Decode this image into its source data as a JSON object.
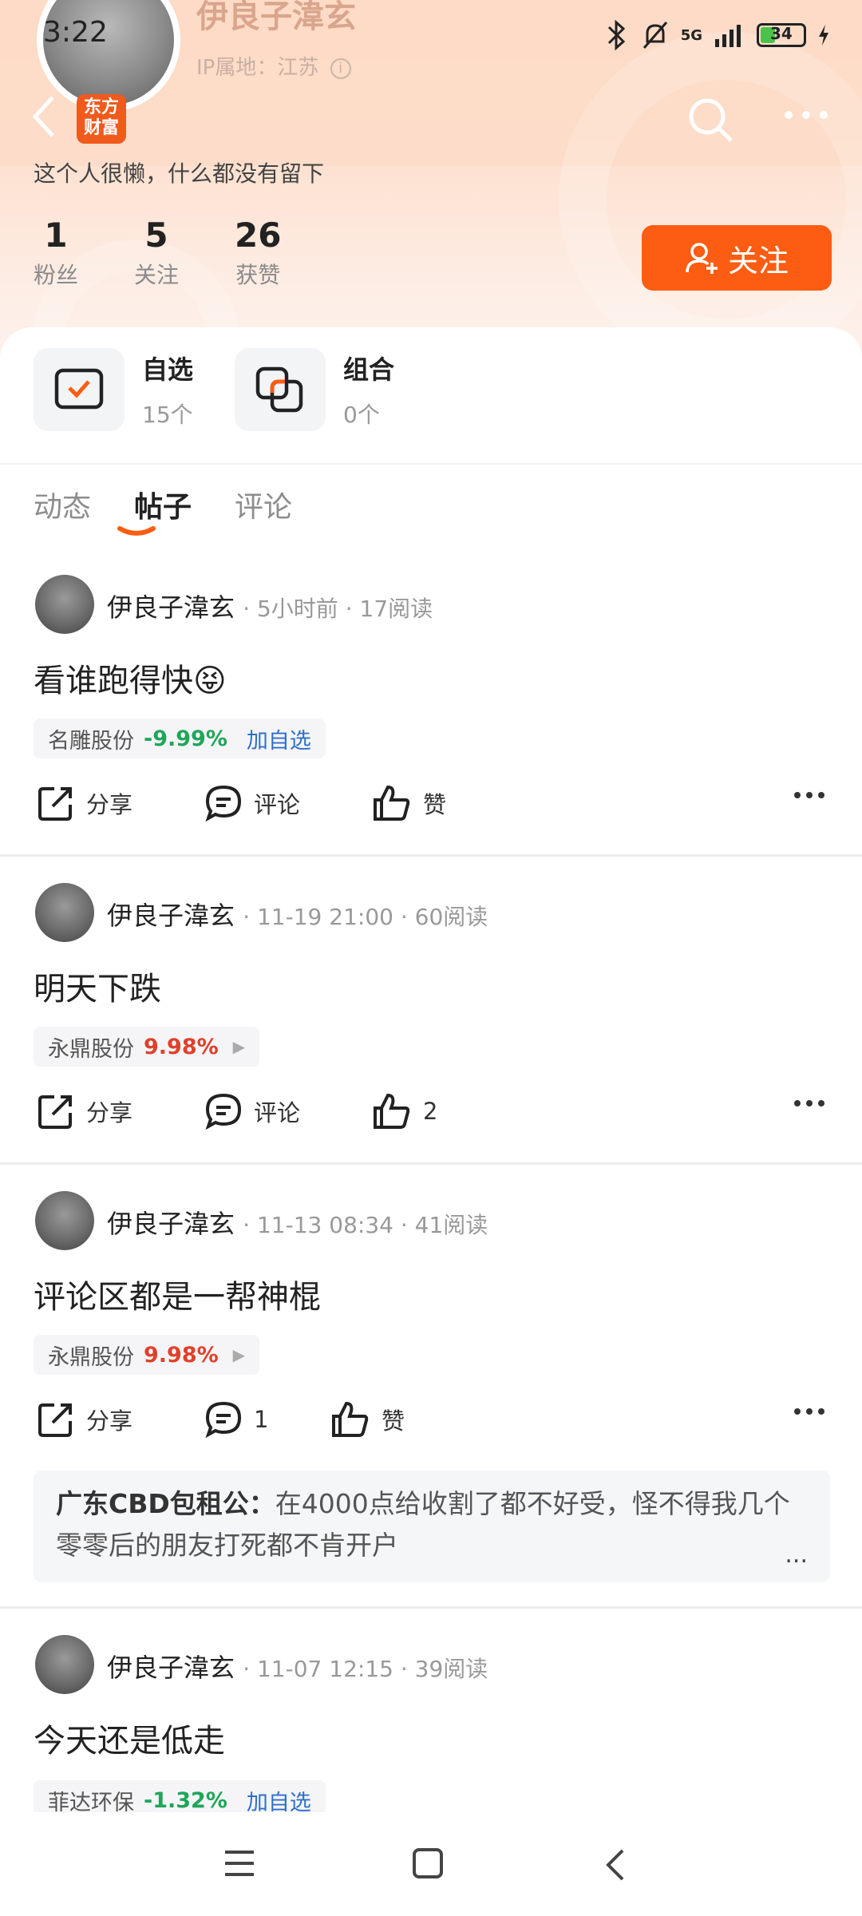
{
  "status_bar": {
    "time": "3:22",
    "network": "5G",
    "battery": "34"
  },
  "profile": {
    "name": "伊良子湋玄",
    "ip_location": "IP属地：江苏",
    "brand_badge": "东方\n财富",
    "bio": "这个人很懒，什么都没有留下",
    "stats": [
      {
        "num": "1",
        "label": "粉丝"
      },
      {
        "num": "5",
        "label": "关注"
      },
      {
        "num": "26",
        "label": "获赞"
      }
    ],
    "follow_label": "关注"
  },
  "quick_links": [
    {
      "title": "自选",
      "sub": "15个"
    },
    {
      "title": "组合",
      "sub": "0个"
    }
  ],
  "tabs": [
    "动态",
    "帖子",
    "评论"
  ],
  "active_tab": "帖子",
  "actions": {
    "share": "分享",
    "comment": "评论",
    "like": "赞",
    "add_watch": "加自选"
  },
  "posts": [
    {
      "author": "伊良子湋玄",
      "sub": "· 5小时前 · 17阅读",
      "body": "看谁跑得快😝",
      "stock": "名雕股份",
      "change": "-9.99%",
      "comment_count": "评论",
      "like_count": "赞"
    },
    {
      "author": "伊良子湋玄",
      "sub": "· 11-19 21:00 · 60阅读",
      "body": "明天下跌",
      "stock": "永鼎股份",
      "change": "9.98%",
      "comment_count": "评论",
      "like_count": "2"
    },
    {
      "author": "伊良子湋玄",
      "sub": "· 11-13 08:34 · 41阅读",
      "body": "评论区都是一帮神棍",
      "stock": "永鼎股份",
      "change": "9.98%",
      "comment_count": "1",
      "like_count": "赞",
      "top_comment_user": "广东CBD包租公：",
      "top_comment_text": "在4000点给收割了都不好受，怪不得我几个零零后的朋友打死都不肯开户",
      "top_comment_more": "..."
    },
    {
      "author": "伊良子湋玄",
      "sub": "· 11-07 12:15 · 39阅读",
      "body": "今天还是低走",
      "stock": "菲达环保",
      "change": "-1.32%"
    }
  ],
  "colors": {
    "accent": "#fc5d12",
    "down": "#1fa65a",
    "up": "#e0402b",
    "link": "#2f6fcc"
  }
}
